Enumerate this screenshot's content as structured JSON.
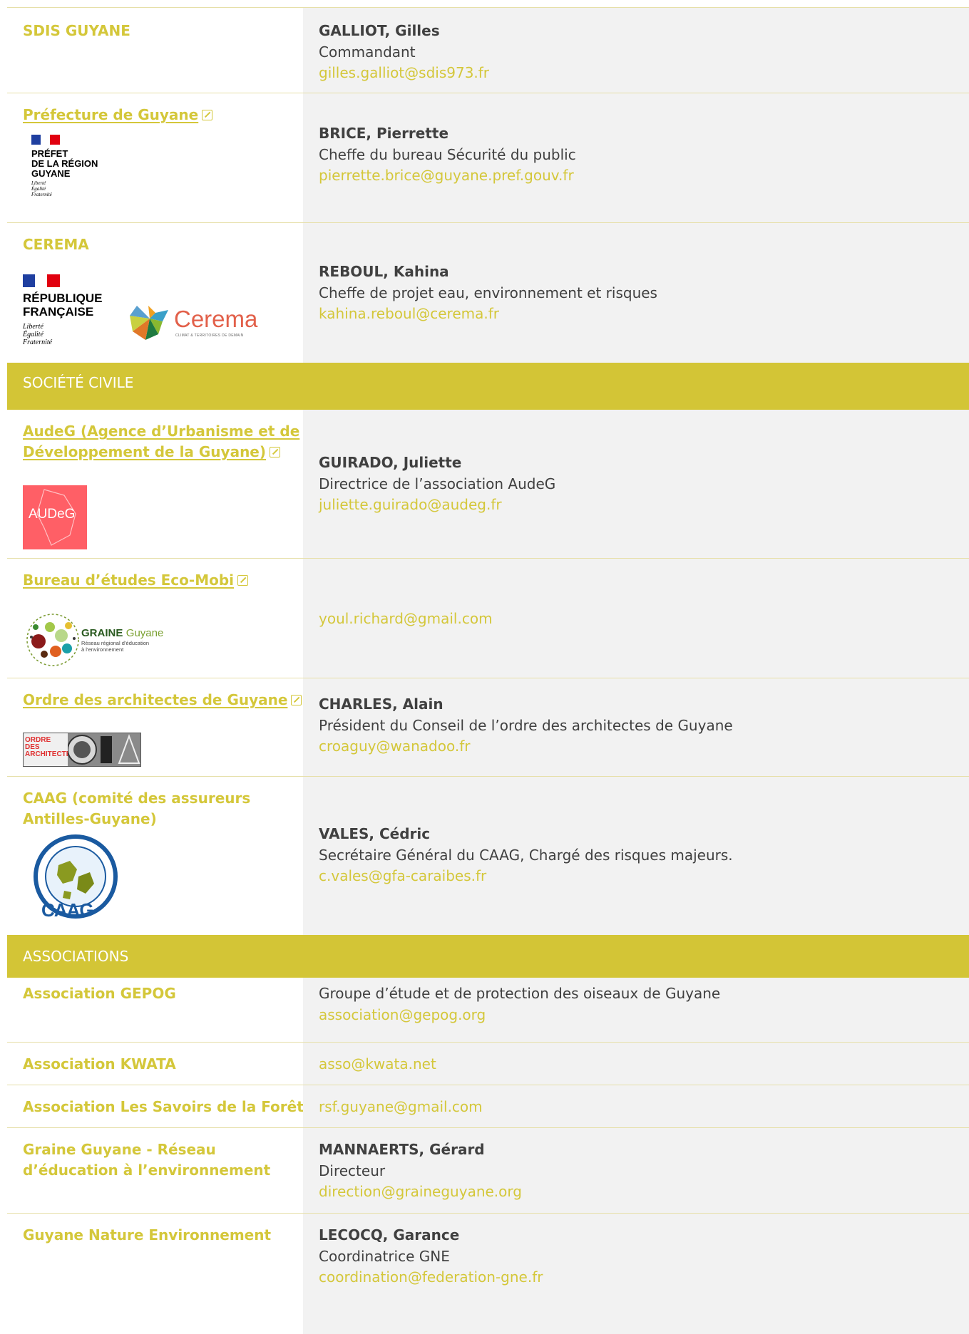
{
  "entries": [
    {
      "org": "SDIS GUYANE",
      "name": "GALLIOT, Gilles",
      "role": "Commandant",
      "email": "gilles.galliot@sdis973.fr"
    },
    {
      "org": "Préfecture de Guyane",
      "name": "BRICE, Pierrette",
      "role": "Cheffe du bureau Sécurité du public",
      "email": "pierrette.brice@guyane.pref.gouv.fr",
      "logo": {
        "l1": "PRÉFET",
        "l2": "DE LA RÉGION",
        "l3": "GUYANE",
        "m1": "Liberté",
        "m2": "Égalité",
        "m3": "Fraternité"
      }
    },
    {
      "org": "CEREMA",
      "name": "REBOUL, Kahina",
      "role": "Cheffe de projet eau, environnement et risques",
      "email": "kahina.reboul@cerema.fr",
      "logo": {
        "l1": "RÉPUBLIQUE",
        "l2": "FRANÇAISE",
        "m1": "Liberté",
        "m2": "Égalité",
        "m3": "Fraternité",
        "cerema": "Cerema",
        "tagline": "CLIMAT & TERRITOIRES DE DEMAIN"
      }
    },
    {
      "org_line1": "AudeG (Agence d’Urbanisme et de",
      "org_line2": "Développement de la Guyane)",
      "name": "GUIRADO, Juliette",
      "role": "Directrice de l’association AudeG",
      "email": "juliette.guirado@audeg.fr",
      "logo": {
        "text": "AUDeG"
      }
    },
    {
      "org": "Bureau d’études Eco-Mobi",
      "email": "youl.richard@gmail.com",
      "logo": {
        "t1": "GRAINE",
        "t2": "Guyane",
        "t3": "Réseau régional d’éducation",
        "t4": "à l’environnement"
      }
    },
    {
      "org": "Ordre des architectes de Guyane",
      "name": "CHARLES, Alain",
      "role": "Président du Conseil de l’ordre des architectes de Guyane",
      "email": "croaguy@wanadoo.fr",
      "logo": {
        "l1": "ORDRE",
        "l2": "DES",
        "l3": "ARCHITECTES"
      }
    },
    {
      "org_line1": "CAAG (comité des assureurs",
      "org_line2": "Antilles-Guyane)",
      "name": "VALES, Cédric",
      "role": "Secrétaire Général du CAAG, Chargé des risques majeurs.",
      "email": "c.vales@gfa-caraibes.fr",
      "logo": {
        "text": "CAAG"
      }
    }
  ],
  "sections": {
    "civil": "SOCIÉTÉ CIVILE",
    "assoc": "ASSOCIATIONS"
  },
  "assocs": [
    {
      "org": "Association GEPOG",
      "role": "Groupe d’étude et de protection des oiseaux de Guyane",
      "email": "association@gepog.org"
    },
    {
      "org": "Association KWATA",
      "email": "asso@kwata.net"
    },
    {
      "org": "Association Les Savoirs de la Forêt",
      "email": "rsf.guyane@gmail.com"
    },
    {
      "org_line1": "Graine Guyane - Réseau",
      "org_line2": "d’éducation à l’environnement",
      "name": "MANNAERTS, Gérard",
      "role": "Directeur",
      "email": "direction@graineguyane.org"
    },
    {
      "org": "Guyane Nature Environnement",
      "name": "LECOCQ, Garance",
      "role": "Coordinatrice GNE",
      "email": "coordination@federation-gne.fr"
    }
  ],
  "colors": {
    "accent": "#d4c73a",
    "section_bg": "#d3c536",
    "right_bg": "#f2f2f2",
    "text": "#404040"
  }
}
